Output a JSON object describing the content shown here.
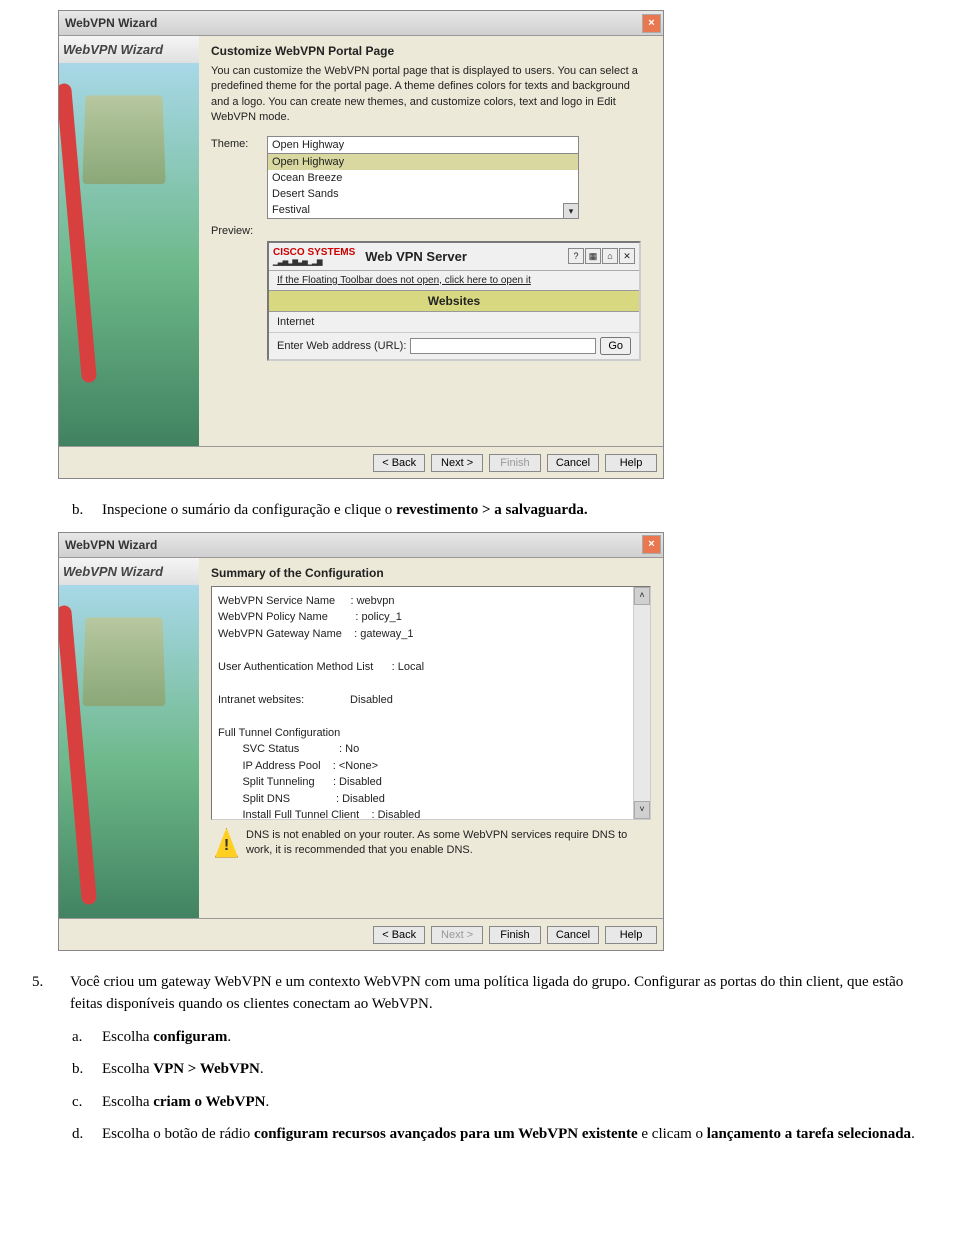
{
  "wizard1": {
    "title": "WebVPN Wizard",
    "banner_logo": "WebVPN Wizard",
    "heading": "Customize WebVPN Portal Page",
    "intro": "You can customize the WebVPN portal page that is displayed to users. You can select a predefined theme for the portal page. A theme defines colors for texts and background and a logo. You can create new themes, and customize colors, text and logo in Edit WebVPN mode.",
    "theme_label": "Theme:",
    "preview_label": "Preview:",
    "theme_selected": "Open Highway",
    "theme_options": [
      "Open Highway",
      "Ocean Breeze",
      "Desert Sands",
      "Festival"
    ],
    "pv_brand": "CISCO SYSTEMS",
    "pv_title": "Web VPN Server",
    "pv_float_link": "If the Floating Toolbar does not open, click here to open it",
    "pv_section": "Websites",
    "pv_internet": "Internet",
    "pv_url_label": "Enter Web address (URL):",
    "pv_go": "Go",
    "btn_back": "< Back",
    "btn_next": "Next >",
    "btn_finish": "Finish",
    "btn_cancel": "Cancel",
    "btn_help": "Help"
  },
  "doc": {
    "step_b": "Inspecione o sumário da configuração e clique o ",
    "step_b_bold": "revestimento > a salvaguarda.",
    "step5_n": "5.",
    "step5": "Você criou um gateway WebVPN e um contexto WebVPN com uma política ligada do grupo. Configurar as portas do thin client, que estão feitas disponíveis quando os clientes conectam ao WebVPN.",
    "sa_m": "a.",
    "sa": "Escolha ",
    "sa_b": "configuram",
    "sb_m": "b.",
    "sb": "Escolha ",
    "sb_b": "VPN > WebVPN",
    "sc_m": "c.",
    "sc": "Escolha ",
    "sc_b": "criam o WebVPN",
    "sd_m": "d.",
    "sd": "Escolha o botão de rádio ",
    "sd_b": "configuram recursos avançados para um WebVPN existente",
    "sd2": " e clicam o ",
    "sd_b2": "lançamento a tarefa selecionada"
  },
  "wizard2": {
    "title": "WebVPN Wizard",
    "banner_logo": "WebVPN Wizard",
    "heading": "Summary of the Configuration",
    "rows": [
      "WebVPN Service Name     : webvpn",
      "WebVPN Policy Name         : policy_1",
      "WebVPN Gateway Name    : gateway_1",
      "",
      "User Authentication Method List      : Local",
      "",
      "Intranet websites:               Disabled",
      "",
      "Full Tunnel Configuration",
      "        SVC Status             : No",
      "        IP Address Pool    : <None>",
      "        Split Tunneling      : Disabled",
      "        Split DNS               : Disabled",
      "        Install Full Tunnel Client    : Disabled"
    ],
    "warn": "DNS is not enabled on your router. As some WebVPN services require DNS to work, it is recommended that you enable DNS.",
    "btn_back": "< Back",
    "btn_next": "Next >",
    "btn_finish": "Finish",
    "btn_cancel": "Cancel",
    "btn_help": "Help"
  }
}
